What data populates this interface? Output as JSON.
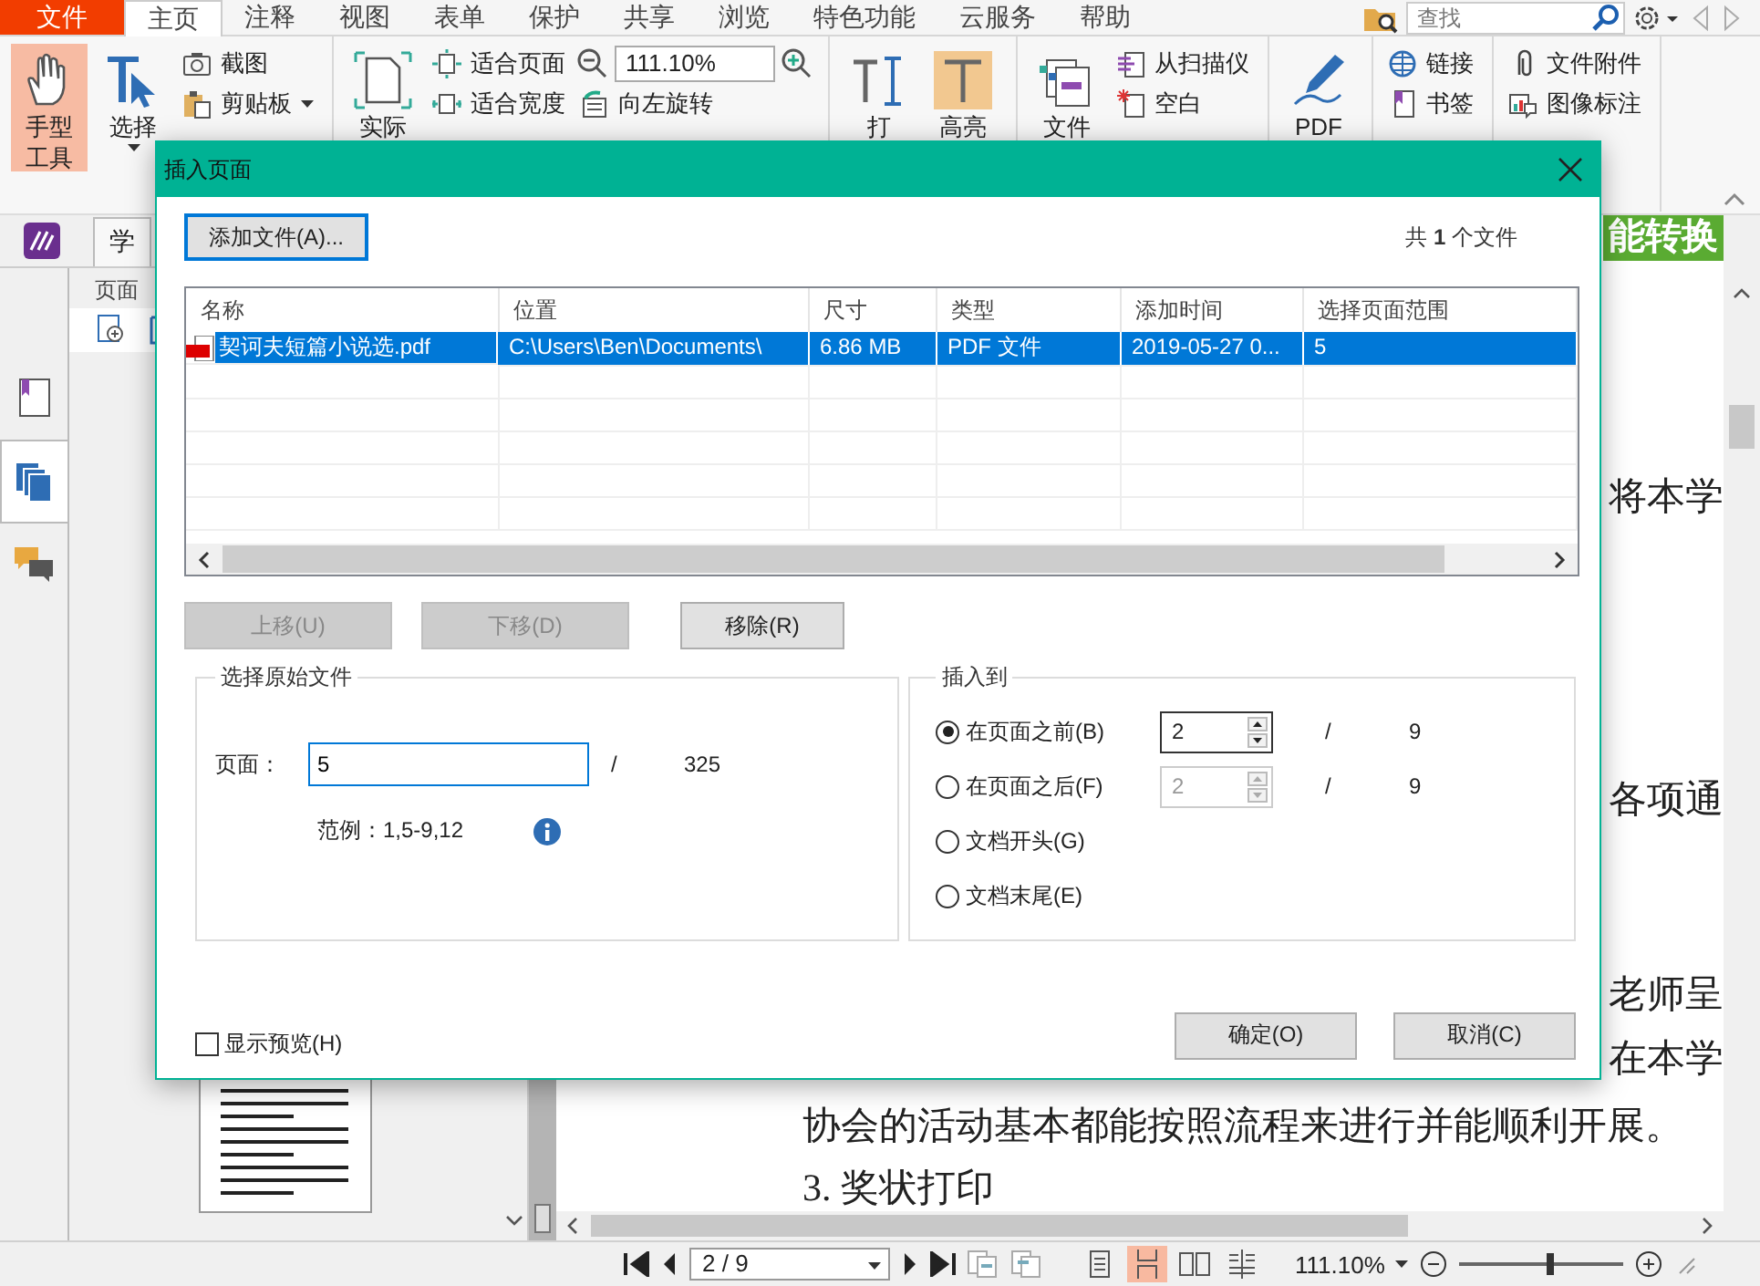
{
  "menu_tabs": [
    {
      "label": "文件",
      "kind": "file",
      "selected": false
    },
    {
      "label": "主页",
      "kind": "tab",
      "selected": true
    },
    {
      "label": "注释",
      "kind": "tab",
      "selected": false
    },
    {
      "label": "视图",
      "kind": "tab",
      "selected": false
    },
    {
      "label": "表单",
      "kind": "tab",
      "selected": false
    },
    {
      "label": "保护",
      "kind": "tab",
      "selected": false
    },
    {
      "label": "共享",
      "kind": "tab",
      "selected": false
    },
    {
      "label": "浏览",
      "kind": "tab",
      "selected": false
    },
    {
      "label": "特色功能",
      "kind": "tab",
      "selected": false
    },
    {
      "label": "云服务",
      "kind": "tab",
      "selected": false
    },
    {
      "label": "帮助",
      "kind": "tab",
      "selected": false
    }
  ],
  "search": {
    "placeholder": "查找"
  },
  "ribbon": {
    "groups": [
      {
        "columns": [
          {
            "kind": "large",
            "lines": [
              "手型",
              "工具"
            ],
            "selected": true,
            "menu": false
          },
          {
            "kind": "large",
            "lines": [
              "选择"
            ],
            "selected": false,
            "menu": true
          },
          {
            "kind": "stack",
            "items": [
              {
                "kind": "button",
                "label": "截图",
                "menu": false
              },
              {
                "kind": "button",
                "label": "剪贴板",
                "menu": true
              }
            ]
          }
        ]
      },
      {
        "columns": [
          {
            "kind": "large",
            "lines": [
              "实际"
            ],
            "selected": false,
            "menu": false
          },
          {
            "kind": "stack",
            "items": [
              {
                "kind": "button",
                "label": "适合页面",
                "menu": false
              },
              {
                "kind": "button",
                "label": "适合宽度",
                "menu": false
              }
            ]
          },
          {
            "kind": "stack",
            "items": [
              {
                "kind": "zoom",
                "value": "111.10%"
              },
              {
                "kind": "button",
                "label": "向左旋转",
                "menu": false
              }
            ]
          }
        ]
      },
      {
        "columns": [
          {
            "kind": "large",
            "lines": [
              "打"
            ],
            "selected": false,
            "menu": false
          },
          {
            "kind": "large",
            "lines": [
              "高亮"
            ],
            "selected": false,
            "menu": false
          }
        ]
      },
      {
        "columns": [
          {
            "kind": "large",
            "lines": [
              "文件"
            ],
            "selected": false,
            "menu": false
          },
          {
            "kind": "stack",
            "items": [
              {
                "kind": "button",
                "label": "从扫描仪",
                "menu": false
              },
              {
                "kind": "button",
                "label": "空白",
                "menu": false
              }
            ]
          }
        ]
      },
      {
        "columns": [
          {
            "kind": "large",
            "lines": [
              "PDF"
            ],
            "selected": false,
            "menu": false
          }
        ]
      },
      {
        "columns": [
          {
            "kind": "stack",
            "items": [
              {
                "kind": "button",
                "label": "链接",
                "menu": false
              },
              {
                "kind": "button",
                "label": "书签",
                "menu": false
              }
            ]
          }
        ]
      },
      {
        "columns": [
          {
            "kind": "stack",
            "items": [
              {
                "kind": "button",
                "label": "文件附件",
                "menu": false
              },
              {
                "kind": "button",
                "label": "图像标注",
                "menu": false
              }
            ]
          }
        ]
      }
    ]
  },
  "side_panel": {
    "tab": "学",
    "title": "页面",
    "nav": [
      {
        "selected": false
      },
      {
        "selected": true
      },
      {
        "selected": false
      }
    ]
  },
  "document": {
    "lines": [
      {
        "kind": "banner",
        "text": "能转换"
      },
      {
        "kind": "fragment",
        "text": "将本学"
      },
      {
        "kind": "fragment",
        "text": "各项通"
      },
      {
        "kind": "fragment",
        "text": "老师呈"
      },
      {
        "kind": "fragment",
        "text": "在本学"
      },
      {
        "kind": "line",
        "text": "协会的活动基本都能按照流程来进行并能顺利开展。"
      },
      {
        "kind": "line",
        "text": "3. 奖状打印"
      }
    ]
  },
  "status_bar": {
    "page": "2 / 9",
    "views": [
      {
        "selected": false
      },
      {
        "selected": true
      },
      {
        "selected": false
      },
      {
        "selected": false
      }
    ],
    "zoom": "111.10%",
    "zoom_slider": {
      "level": 0.55
    }
  },
  "dialog": {
    "title": "插入页面",
    "add_button": "添加文件(A)...",
    "file_count": "共 **1** 个文件",
    "table": {
      "columns": [
        "名称",
        "位置",
        "尺寸",
        "类型",
        "添加时间",
        "选择页面范围"
      ],
      "rows": [
        {
          "selected": true,
          "cells": [
            "契诃夫短篇小说选.pdf",
            "C:\\Users\\Ben\\Documents\\",
            "6.86 MB",
            "PDF 文件",
            "2019-05-27 0...",
            "5"
          ]
        }
      ]
    },
    "move_buttons": [
      {
        "label": "上移(U)",
        "disabled": true
      },
      {
        "label": "下移(D)",
        "disabled": true
      },
      {
        "label": "移除(R)",
        "disabled": false
      }
    ],
    "source": {
      "title": "选择原始文件",
      "page_label": "页面：",
      "page_value": "5",
      "separator": "/",
      "total": "325",
      "example": "范例：1,5-9,12"
    },
    "insert": {
      "title": "插入到",
      "options": [
        {
          "label": "在页面之前(B)",
          "selected": true,
          "spinner": {
            "value": "2",
            "disabled": false
          },
          "separator": "/",
          "total": "9"
        },
        {
          "label": "在页面之后(F)",
          "selected": false,
          "spinner": {
            "value": "2",
            "disabled": true
          },
          "separator": "/",
          "total": "9"
        },
        {
          "label": "文档开头(G)",
          "selected": false
        },
        {
          "label": "文档末尾(E)",
          "selected": false
        }
      ]
    },
    "preview": {
      "label": "显示预览(H)",
      "checked": false
    },
    "buttons": [
      "确定(O)",
      "取消(C)"
    ]
  }
}
